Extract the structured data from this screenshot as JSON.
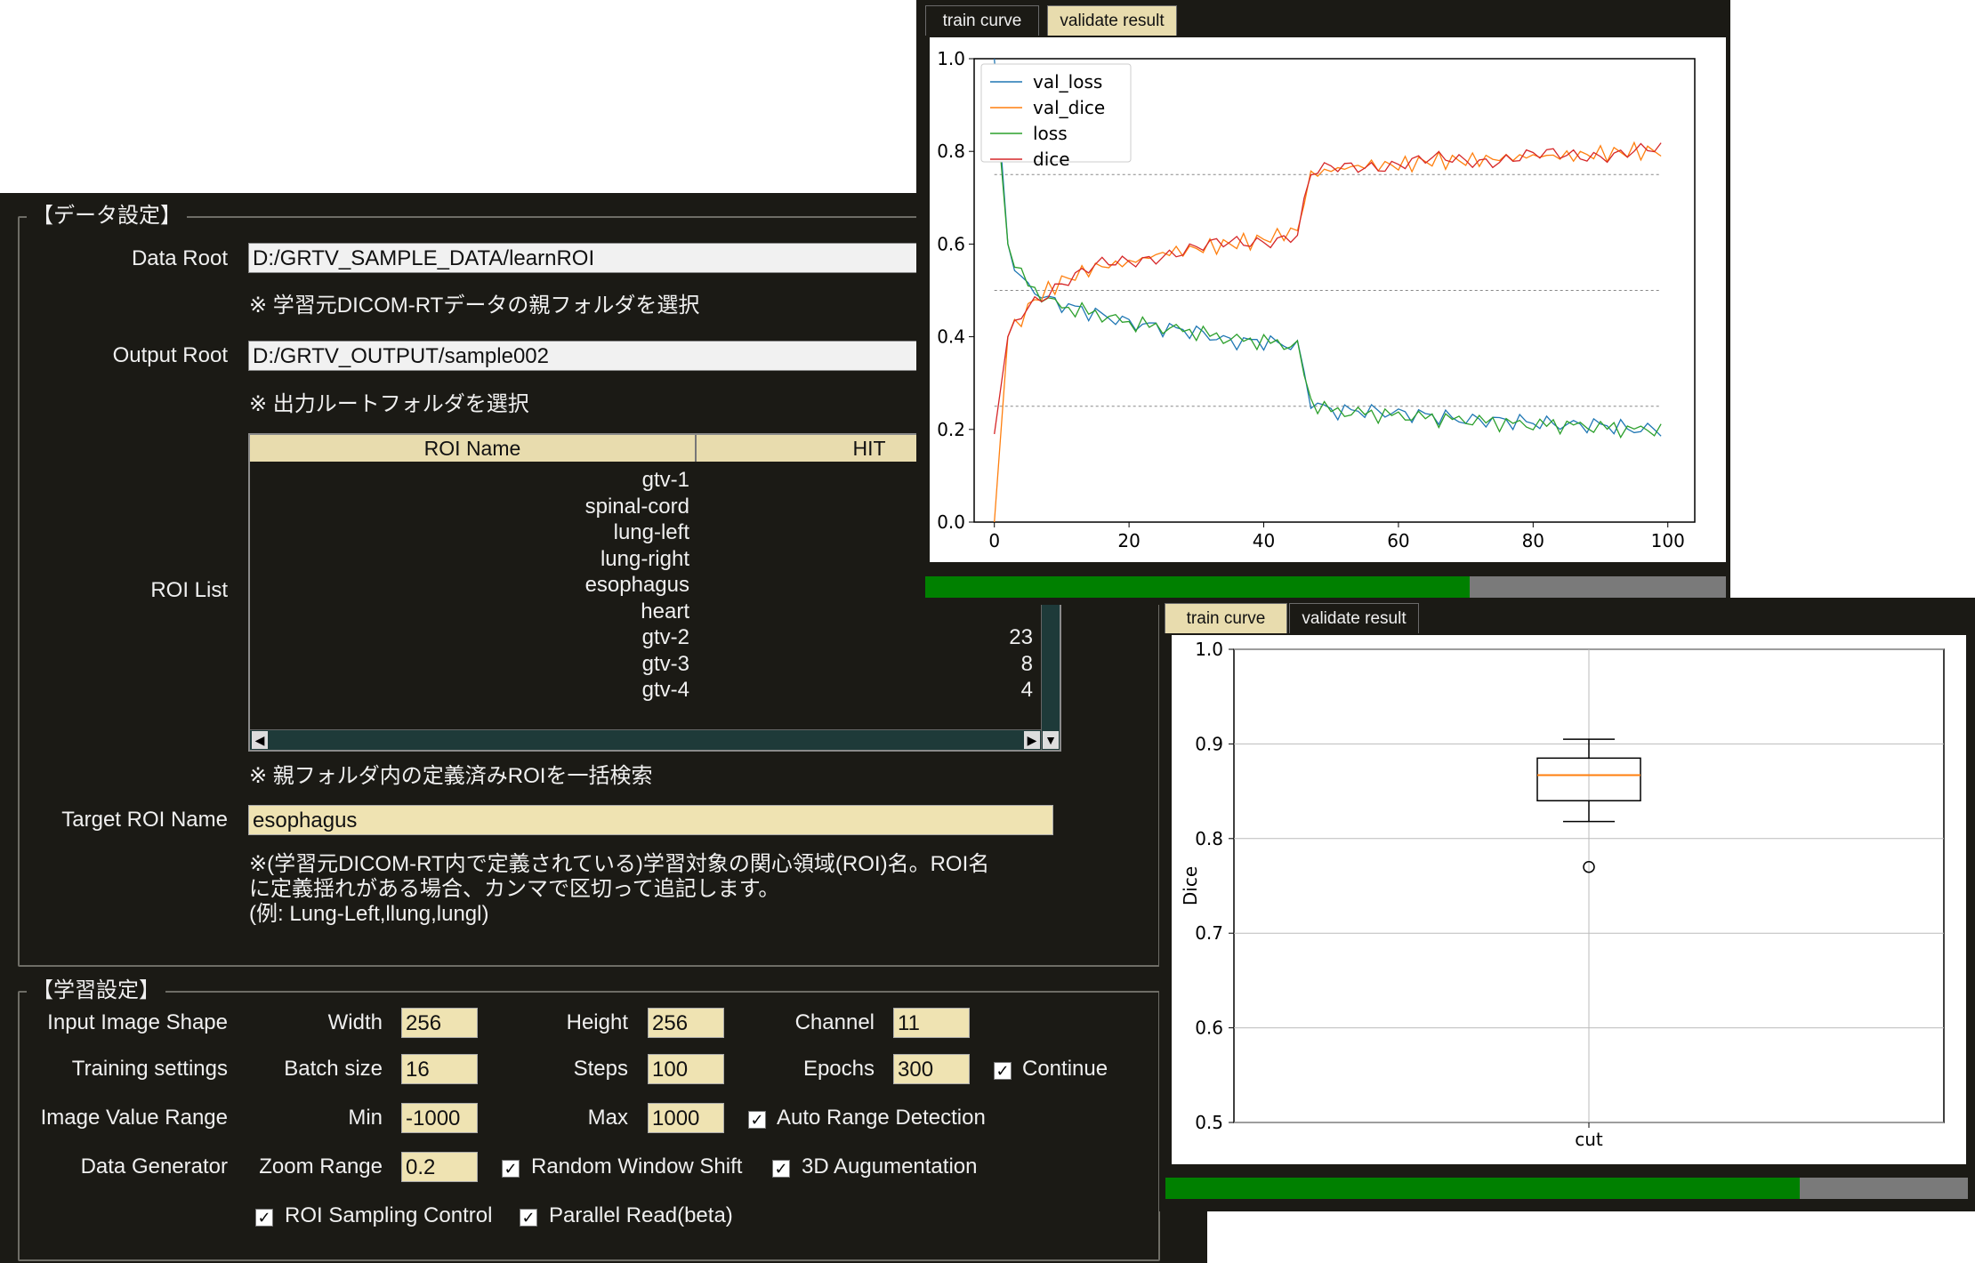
{
  "data_settings": {
    "title": "【データ設定】",
    "data_root_label": "Data Root",
    "data_root_value": "D:/GRTV_SAMPLE_DATA/learnROI",
    "data_root_note": "※ 学習元DICOM-RTデータの親フォルダを選択",
    "output_root_label": "Output Root",
    "output_root_value": "D:/GRTV_OUTPUT/sample002",
    "output_root_note": "※ 出力ルートフォルダを選択",
    "roi_list_label": "ROI List",
    "roi_table": {
      "headers": [
        "ROI Name",
        "HIT"
      ],
      "rows": [
        {
          "name": "gtv-1",
          "hit": ""
        },
        {
          "name": "spinal-cord",
          "hit": ""
        },
        {
          "name": "lung-left",
          "hit": ""
        },
        {
          "name": "lung-right",
          "hit": ""
        },
        {
          "name": "esophagus",
          "hit": ""
        },
        {
          "name": "heart",
          "hit": ""
        },
        {
          "name": "gtv-2",
          "hit": "23"
        },
        {
          "name": "gtv-3",
          "hit": "8"
        },
        {
          "name": "gtv-4",
          "hit": "4"
        }
      ]
    },
    "roi_note": "※ 親フォルダ内の定義済みROIを一括検索",
    "target_roi_label": "Target ROI Name",
    "target_roi_value": "esophagus",
    "target_note_1": "※(学習元DICOM-RT内で定義されている)学習対象の関心領域(ROI)名。ROI名",
    "target_note_2": "に定義揺れがある場合、カンマで区切って追記します。",
    "target_note_3": "(例: Lung-Left,llung,lungl)"
  },
  "learning_settings": {
    "title": "【学習設定】",
    "input_image_shape_label": "Input Image Shape",
    "width_label": "Width",
    "width_value": "256",
    "height_label": "Height",
    "height_value": "256",
    "channel_label": "Channel",
    "channel_value": "11",
    "training_settings_label": "Training settings",
    "batch_size_label": "Batch size",
    "batch_size_value": "16",
    "steps_label": "Steps",
    "steps_value": "100",
    "epochs_label": "Epochs",
    "epochs_value": "300",
    "continue_label": "Continue",
    "image_value_range_label": "Image Value Range",
    "min_label": "Min",
    "min_value": "-1000",
    "max_label": "Max",
    "max_value": "1000",
    "auto_range_label": "Auto Range Detection",
    "data_generator_label": "Data Generator",
    "zoom_range_label": "Zoom Range",
    "zoom_range_value": "0.2",
    "random_window_shift_label": "Random Window Shift",
    "augmentation_label": "3D Augumentation",
    "roi_sampling_label": "ROI Sampling Control",
    "parallel_read_label": "Parallel Read(beta)",
    "check_mark": "✓"
  },
  "curve_window": {
    "tabs": [
      "train curve",
      "validate result"
    ],
    "active_tab": 1,
    "progress": 0.68
  },
  "validate_window": {
    "tabs": [
      "train curve",
      "validate result"
    ],
    "active_tab": 0,
    "progress": 0.79
  },
  "colors": {
    "val_loss": "#1f77b4",
    "val_dice": "#ff7f0e",
    "loss": "#2ca02c",
    "dice": "#d62728",
    "progress_fill": "#008000",
    "field_yellow": "#efe3b2",
    "panel_bg": "#1b1a15"
  },
  "chart_data": [
    {
      "type": "line",
      "title": "",
      "xlabel": "",
      "ylabel": "",
      "xlim": [
        -3,
        104
      ],
      "ylim": [
        0.0,
        1.0
      ],
      "xticks": [
        "0",
        "20",
        "40",
        "60",
        "80",
        "100"
      ],
      "yticks": [
        "0.0",
        "0.2",
        "0.4",
        "0.6",
        "0.8",
        "1.0"
      ],
      "hlines": [
        0.75,
        0.5,
        0.25
      ],
      "legend_position": "upper-left",
      "series": [
        {
          "name": "val_loss",
          "x": [
            0,
            2,
            4,
            6,
            8,
            10,
            15,
            20,
            25,
            30,
            35,
            40,
            45,
            47,
            50,
            55,
            60,
            65,
            70,
            75,
            80,
            85,
            90,
            95,
            99
          ],
          "y": [
            1.0,
            0.6,
            0.52,
            0.5,
            0.48,
            0.47,
            0.45,
            0.43,
            0.42,
            0.41,
            0.39,
            0.39,
            0.38,
            0.26,
            0.24,
            0.24,
            0.235,
            0.23,
            0.22,
            0.22,
            0.215,
            0.21,
            0.21,
            0.2,
            0.2
          ]
        },
        {
          "name": "val_dice",
          "x": [
            0,
            2,
            4,
            6,
            8,
            10,
            15,
            20,
            25,
            30,
            35,
            40,
            45,
            47,
            50,
            55,
            60,
            65,
            70,
            75,
            80,
            85,
            90,
            95,
            99
          ],
          "y": [
            0.0,
            0.4,
            0.44,
            0.48,
            0.5,
            0.52,
            0.55,
            0.56,
            0.58,
            0.59,
            0.6,
            0.61,
            0.63,
            0.75,
            0.76,
            0.77,
            0.77,
            0.78,
            0.78,
            0.785,
            0.79,
            0.79,
            0.795,
            0.8,
            0.8
          ]
        },
        {
          "name": "loss",
          "x": [
            0,
            2,
            4,
            6,
            8,
            10,
            15,
            20,
            25,
            30,
            35,
            40,
            45,
            47,
            50,
            55,
            60,
            65,
            70,
            75,
            80,
            85,
            90,
            95,
            99
          ],
          "y": [
            0.95,
            0.6,
            0.53,
            0.5,
            0.48,
            0.465,
            0.45,
            0.43,
            0.42,
            0.41,
            0.395,
            0.39,
            0.38,
            0.26,
            0.24,
            0.235,
            0.23,
            0.225,
            0.22,
            0.215,
            0.21,
            0.21,
            0.205,
            0.2,
            0.2
          ]
        },
        {
          "name": "dice",
          "x": [
            0,
            2,
            4,
            6,
            8,
            10,
            15,
            20,
            25,
            30,
            35,
            40,
            45,
            47,
            50,
            55,
            60,
            65,
            70,
            75,
            80,
            85,
            90,
            95,
            99
          ],
          "y": [
            0.19,
            0.4,
            0.45,
            0.48,
            0.5,
            0.52,
            0.55,
            0.56,
            0.58,
            0.59,
            0.6,
            0.61,
            0.62,
            0.75,
            0.76,
            0.77,
            0.775,
            0.78,
            0.78,
            0.785,
            0.79,
            0.79,
            0.795,
            0.8,
            0.8
          ]
        }
      ]
    },
    {
      "type": "box",
      "title": "",
      "xlabel": "",
      "ylabel": "Dice",
      "ylim": [
        0.5,
        1.0
      ],
      "yticks": [
        "0.5",
        "0.6",
        "0.7",
        "0.8",
        "0.9",
        "1.0"
      ],
      "categories": [
        "cut"
      ],
      "box": {
        "whisker_low": 0.818,
        "q1": 0.84,
        "median": 0.867,
        "q3": 0.885,
        "whisker_high": 0.905,
        "outliers": [
          0.77
        ]
      }
    }
  ]
}
